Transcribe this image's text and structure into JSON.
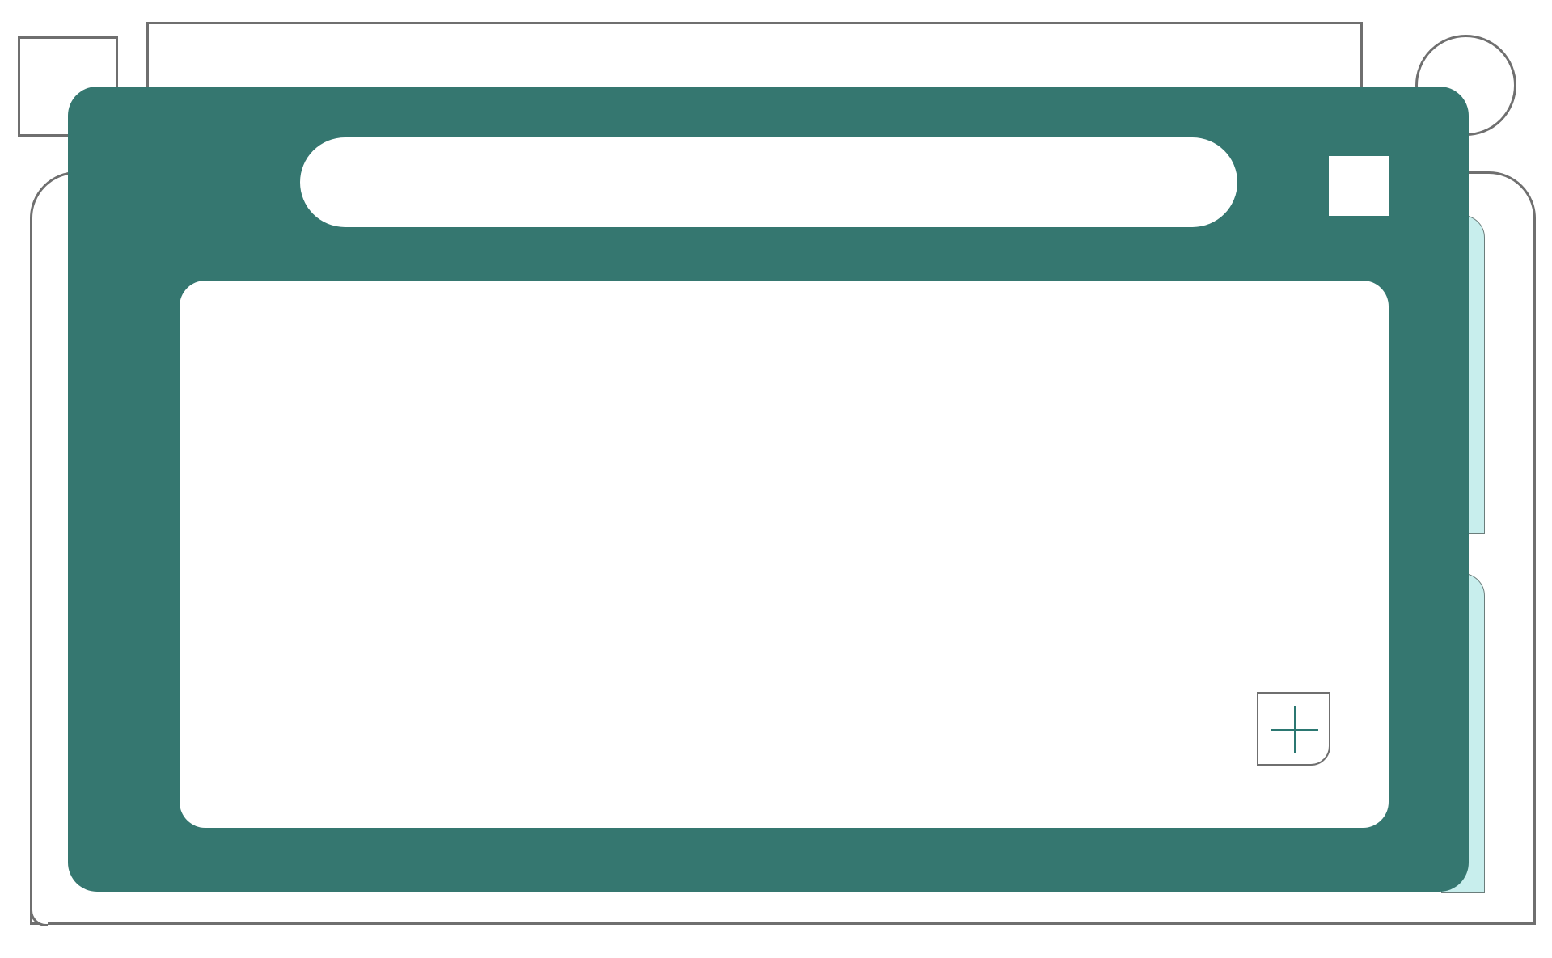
{
  "colors": {
    "panel": "#357770",
    "side_tabs": "#c8eeed",
    "outline": "#6f6f6f",
    "accent": "#2b7771",
    "surface": "#ffffff"
  },
  "icons": {
    "add": "plus-icon"
  }
}
